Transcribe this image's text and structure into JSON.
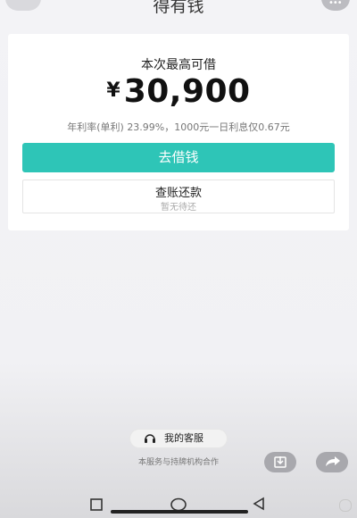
{
  "header": {
    "close_label": "×",
    "title": "得有钱",
    "more_label": "•••"
  },
  "card": {
    "heading": "本次最高可借",
    "currency": "¥",
    "amount": "30,900",
    "rate_text": "年利率(单利) 23.99%，1000元一日利息仅0.67元",
    "borrow_button": "去借钱",
    "repay_title": "查账还款",
    "repay_sub": "暂无待还"
  },
  "footer": {
    "service_label": "我的客服",
    "note": "本服务与持牌机构合作"
  },
  "colors": {
    "accent": "#2ec5b7"
  }
}
